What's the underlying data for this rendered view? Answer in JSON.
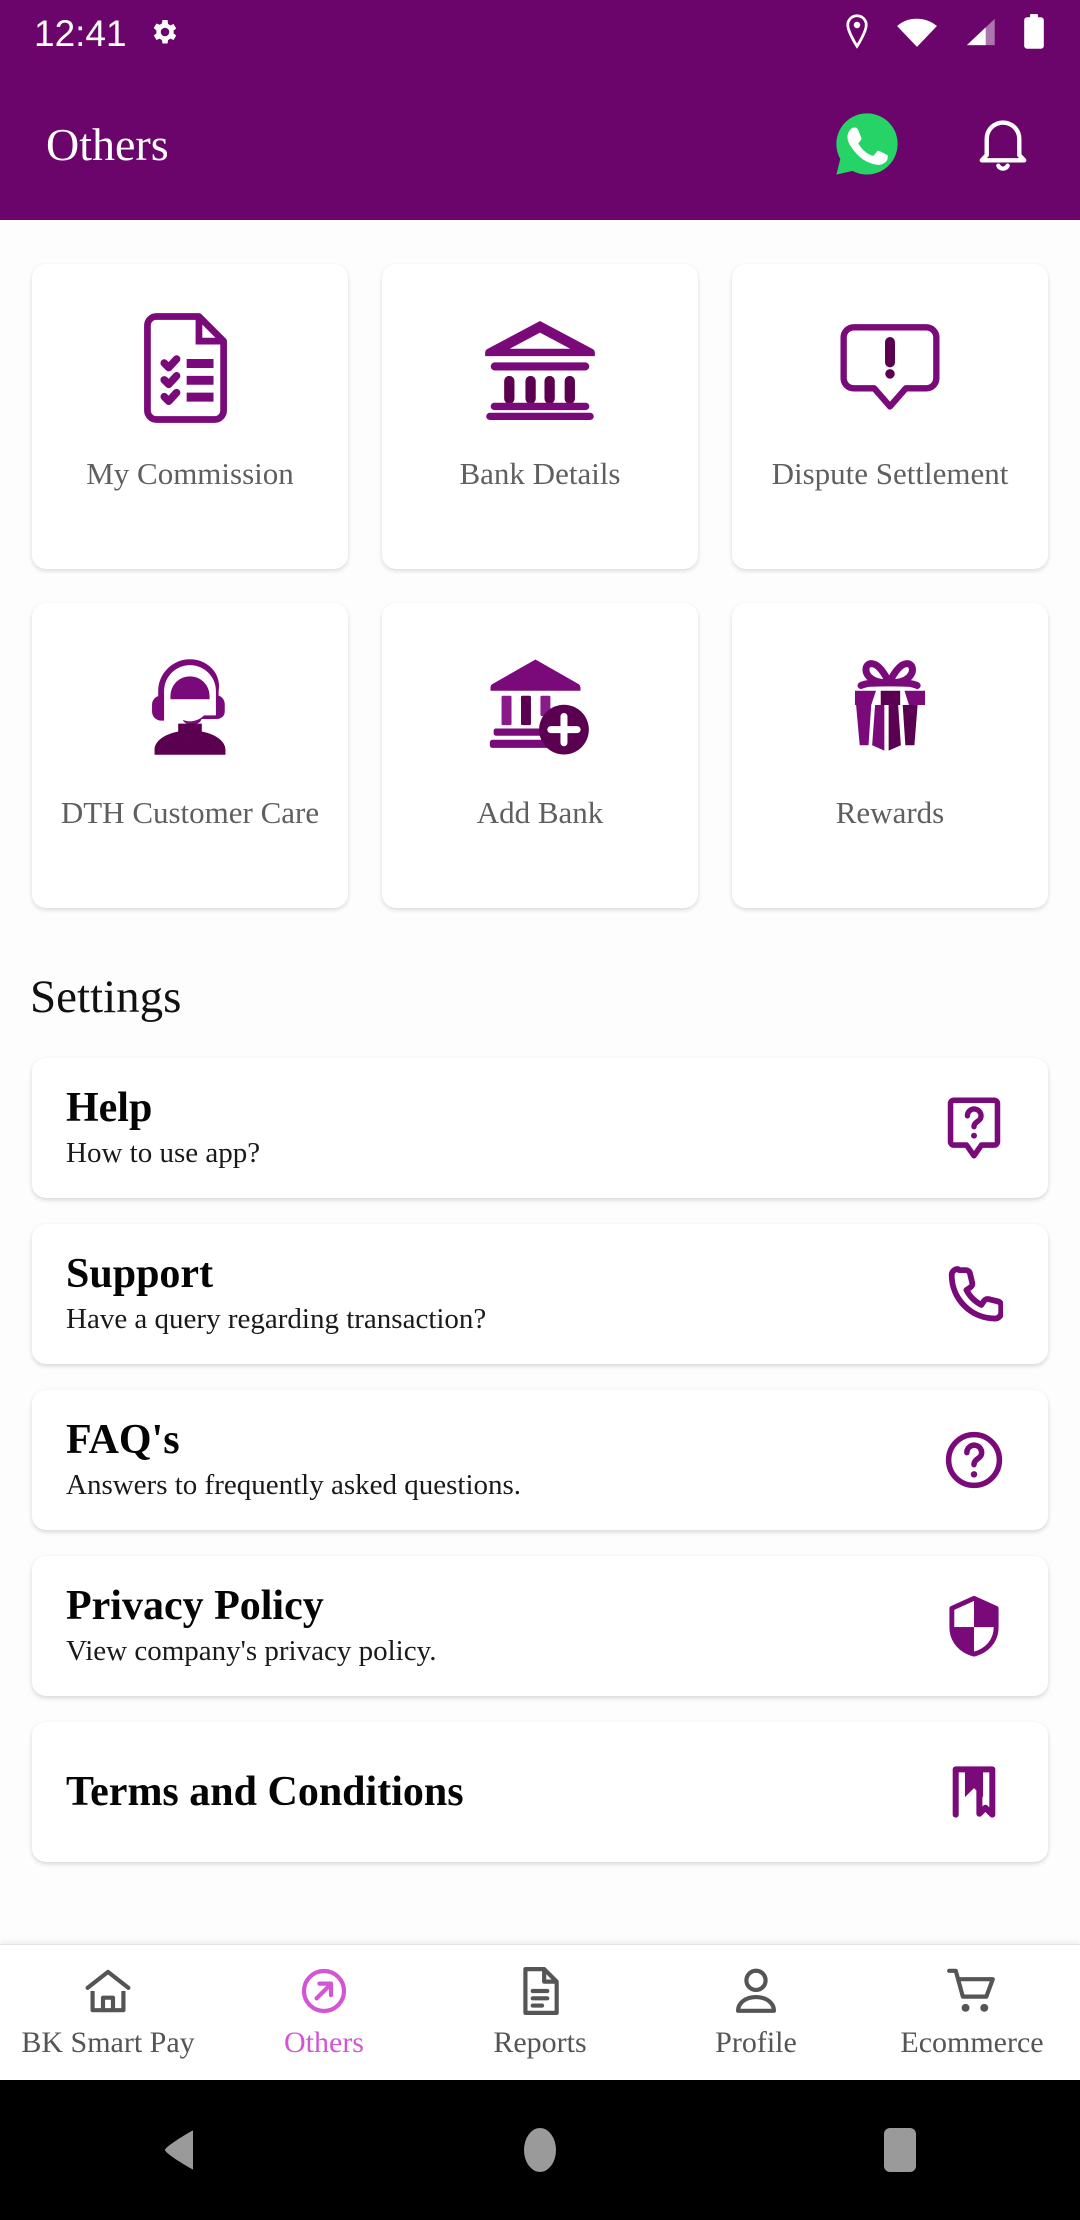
{
  "colors": {
    "brand_purple": "#6B056B",
    "icon_purple": "#7A0A7A",
    "accent_pink": "#D455D4",
    "whatsapp_green": "#25D366",
    "tile_label_gray": "#5F5F5F",
    "nav_gray": "#555555"
  },
  "status_bar": {
    "time": "12:41",
    "icons": [
      "gear-icon",
      "location-pin-icon",
      "wifi-icon",
      "cellular-signal-icon",
      "battery-icon"
    ]
  },
  "app_bar": {
    "title": "Others",
    "actions": [
      {
        "name": "whatsapp-icon",
        "label": "WhatsApp"
      },
      {
        "name": "notification-bell-icon",
        "label": "Notifications"
      }
    ]
  },
  "grid": {
    "tiles": [
      {
        "label": "My Commission",
        "icon": "document-checklist-icon"
      },
      {
        "label": "Bank Details",
        "icon": "bank-building-icon"
      },
      {
        "label": "Dispute Settlement",
        "icon": "speech-bubble-exclamation-icon"
      },
      {
        "label": "DTH Customer Care",
        "icon": "headset-agent-icon"
      },
      {
        "label": "Add Bank",
        "icon": "bank-add-icon"
      },
      {
        "label": "Rewards",
        "icon": "gift-box-icon"
      }
    ]
  },
  "settings": {
    "heading": "Settings",
    "items": [
      {
        "title": "Help",
        "subtitle": "How to use app?",
        "icon": "help-bubble-question-icon"
      },
      {
        "title": "Support",
        "subtitle": "Have a query regarding transaction?",
        "icon": "phone-handset-icon"
      },
      {
        "title": "FAQ's",
        "subtitle": "Answers to frequently asked questions.",
        "icon": "question-circle-icon"
      },
      {
        "title": "Privacy Policy",
        "subtitle": "View company's privacy policy.",
        "icon": "shield-icon"
      },
      {
        "title": "Terms and Conditions",
        "subtitle": "",
        "icon": "bookmark-icon"
      }
    ]
  },
  "bottom_nav": {
    "items": [
      {
        "label": "BK Smart Pay",
        "icon": "home-icon",
        "active": false
      },
      {
        "label": "Others",
        "icon": "circle-arrow-icon",
        "active": true
      },
      {
        "label": "Reports",
        "icon": "document-icon",
        "active": false
      },
      {
        "label": "Profile",
        "icon": "person-icon",
        "active": false
      },
      {
        "label": "Ecommerce",
        "icon": "shopping-cart-icon",
        "active": false
      }
    ]
  },
  "system_nav": {
    "buttons": [
      {
        "name": "android-back-button"
      },
      {
        "name": "android-home-button"
      },
      {
        "name": "android-recents-button"
      }
    ]
  }
}
